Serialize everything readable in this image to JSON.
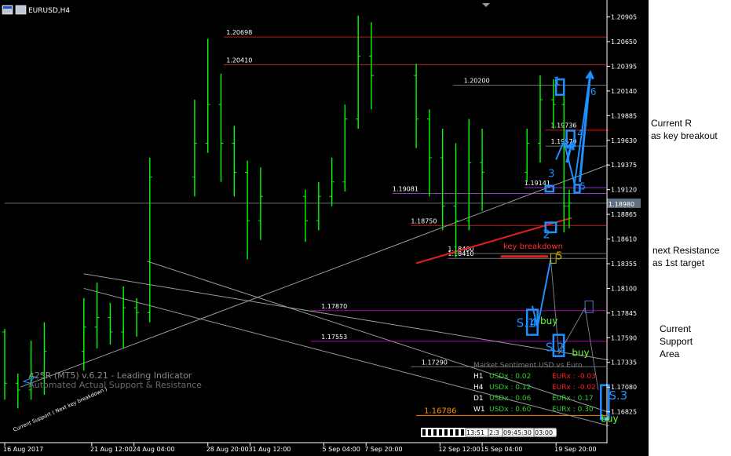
{
  "window": {
    "title": "EURUSD,H4"
  },
  "price_axis": {
    "ticks": [
      "1.20905",
      "1.20650",
      "1.20395",
      "1.20140",
      "1.19885",
      "1.19630",
      "1.19375",
      "1.19120",
      "1.18865",
      "1.18610",
      "1.18355",
      "1.18100",
      "1.17845",
      "1.17590",
      "1.17335",
      "1.17080",
      "1.16825"
    ],
    "current_price": "1.18980"
  },
  "time_axis": {
    "labels": [
      "16 Aug 2017",
      "21 Aug 12:00",
      "24 Aug 04:00",
      "28 Aug 20:00",
      "31 Aug 12:00",
      "5 Sep 04:00",
      "7 Sep 20:00",
      "12 Sep 12:00",
      "15 Sep 04:00",
      "19 Sep 20:00"
    ]
  },
  "levels": [
    {
      "label": "1.20698",
      "value": 1.20698,
      "color": "#b22222",
      "x_start": "29 Aug 20:00",
      "label_at": "30 Aug 00:00"
    },
    {
      "label": "1.20410",
      "value": 1.2041,
      "color": "#b22222",
      "x_start": "29 Aug 20:00",
      "label_at": "30 Aug 00:00"
    },
    {
      "label": "1.20200",
      "value": 1.202,
      "color": "#707070",
      "x_start": "13 Sep 08:00",
      "label_at": "14 Sep 00:00"
    },
    {
      "label": "1.19736",
      "value": 1.19736,
      "color": "#b22222",
      "x_start": "19 Sep 04:00",
      "label_at": "19 Sep 12:00"
    },
    {
      "label": "1.19570",
      "value": 1.1957,
      "color": "#707070",
      "x_start": "19 Sep 04:00",
      "label_at": "19 Sep 12:00"
    },
    {
      "label": "1.19081",
      "value": 1.19081,
      "color": "#9932cc",
      "x_start": "9 Sep 12:00",
      "label_at": "9 Sep 12:00"
    },
    {
      "label": "1.19141",
      "value": 1.19141,
      "color": "#9932cc",
      "x_start": "17 Sep 20:00",
      "label_at": "17 Sep 20:00"
    },
    {
      "label": "1.18750",
      "value": 1.1875,
      "color": "#b22222",
      "x_start": "10 Sep 16:00",
      "label_at": "10 Sep 16:00"
    },
    {
      "label": "1.18460",
      "value": 1.1846,
      "color": "#707070",
      "x_start": "13 Sep 00:00",
      "label_at": "13 Sep 00:00"
    },
    {
      "label": "1.18410",
      "value": 1.1841,
      "color": "#707070",
      "x_start": "13 Sep 00:00",
      "label_at": "13 Sep 00:00"
    },
    {
      "label": "1.17870",
      "value": 1.1787,
      "color": "#b000b0",
      "x_start": "4 Sep 08:00",
      "label_at": "5 Sep 00:00"
    },
    {
      "label": "1.17553",
      "value": 1.17553,
      "color": "#b000b0",
      "x_start": "4 Sep 08:00",
      "label_at": "5 Sep 00:00"
    },
    {
      "label": "1.17290",
      "value": 1.1729,
      "color": "#707070",
      "x_start": "10 Sep 16:00",
      "label_at": "11 Sep 08:00"
    },
    {
      "label": "1.16786",
      "value": 1.16786,
      "color": "#ff8c00",
      "x_start": "11 Sep 00:00",
      "label_at": "11 Sep 12:00"
    }
  ],
  "chart_data": {
    "type": "candlestick",
    "title": "EURUSD,H4",
    "x_range": [
      "16 Aug 2017 00:00",
      "23 Sep 2017 04:00"
    ],
    "ylim": [
      1.1653,
      1.2108
    ],
    "current_price": 1.1898,
    "series": [
      {
        "name": "EURUSD,H4",
        "values": [
          [
            "16 Aug 00:00",
            1.1765,
            1.1768,
            1.1695,
            1.1712
          ],
          [
            "16 Aug 20:00",
            1.1712,
            1.1722,
            1.1686,
            1.1705
          ],
          [
            "17 Aug 16:00",
            1.1705,
            1.1756,
            1.1695,
            1.1722
          ],
          [
            "18 Aug 12:00",
            1.1722,
            1.1775,
            1.17,
            1.1745
          ],
          [
            "21 Aug 00:00",
            1.1745,
            1.18,
            1.1725,
            1.177
          ],
          [
            "21 Aug 20:00",
            1.177,
            1.1816,
            1.1748,
            1.178
          ],
          [
            "22 Aug 16:00",
            1.178,
            1.1795,
            1.1752,
            1.1765
          ],
          [
            "23 Aug 12:00",
            1.1765,
            1.1812,
            1.1748,
            1.179
          ],
          [
            "24 Aug 08:00",
            1.179,
            1.18,
            1.176,
            1.1785
          ],
          [
            "25 Aug 04:00",
            1.1785,
            1.1945,
            1.1775,
            1.1925
          ],
          [
            "28 Aug 00:00",
            1.1925,
            1.2005,
            1.1905,
            1.196
          ],
          [
            "28 Aug 20:00",
            1.196,
            1.2068,
            1.195,
            1.2
          ],
          [
            "29 Aug 16:00",
            1.2,
            1.2032,
            1.192,
            1.196
          ],
          [
            "30 Aug 12:00",
            1.196,
            1.1978,
            1.1905,
            1.193
          ],
          [
            "31 Aug 08:00",
            1.193,
            1.1942,
            1.184,
            1.188
          ],
          [
            "1 Sep 04:00",
            1.188,
            1.1935,
            1.186,
            1.1905
          ],
          [
            "4 Sep 00:00",
            1.1905,
            1.1912,
            1.1858,
            1.188
          ],
          [
            "4 Sep 20:00",
            1.188,
            1.192,
            1.187,
            1.1905
          ],
          [
            "5 Sep 16:00",
            1.1905,
            1.1945,
            1.1895,
            1.192
          ],
          [
            "6 Sep 12:00",
            1.192,
            1.2,
            1.191,
            1.1985
          ],
          [
            "7 Sep 08:00",
            1.1985,
            1.2092,
            1.1975,
            1.205
          ],
          [
            "8 Sep 04:00",
            1.205,
            1.2085,
            1.1995,
            1.203
          ],
          [
            "11 Sep 00:00",
            1.203,
            1.2042,
            1.1955,
            1.1985
          ],
          [
            "11 Sep 20:00",
            1.1985,
            1.1995,
            1.1905,
            1.1945
          ],
          [
            "12 Sep 16:00",
            1.1945,
            1.1975,
            1.187,
            1.1895
          ],
          [
            "13 Sep 12:00",
            1.1895,
            1.196,
            1.1842,
            1.188
          ],
          [
            "14 Sep 08:00",
            1.188,
            1.1985,
            1.187,
            1.194
          ],
          [
            "15 Sep 04:00",
            1.194,
            1.1975,
            1.189,
            1.193
          ],
          [
            "18 Sep 00:00",
            1.193,
            1.1975,
            1.192,
            1.196
          ],
          [
            "18 Sep 20:00",
            1.196,
            1.203,
            1.194,
            1.2005
          ],
          [
            "19 Sep 16:00",
            1.2005,
            1.2026,
            1.1975,
            1.2
          ],
          [
            "20 Sep 08:00",
            1.2,
            1.2015,
            1.1868,
            1.1895
          ],
          [
            "20 Sep 16:00",
            1.1895,
            1.1912,
            1.1872,
            1.1898
          ]
        ]
      }
    ]
  },
  "trendlines": [
    {
      "name": "support-line",
      "from": [
        "17 Aug 00:00",
        1.1708
      ],
      "to": [
        "23 Sep 04:00",
        1.1938
      ],
      "color": "#9a9a9a",
      "width": 1
    },
    {
      "name": "channel-upper",
      "from": [
        "21 Aug 00:00",
        1.1825
      ],
      "to": [
        "23 Sep 04:00",
        1.1736
      ],
      "color": "#9a9a9a",
      "width": 1
    },
    {
      "name": "channel-middle",
      "from": [
        "25 Aug 00:00",
        1.1838
      ],
      "to": [
        "23 Sep 04:00",
        1.1682
      ],
      "color": "#9a9a9a",
      "width": 1
    },
    {
      "name": "channel-lower",
      "from": [
        "21 Aug 00:00",
        1.181
      ],
      "to": [
        "23 Sep 04:00",
        1.1668
      ],
      "color": "#9a9a9a",
      "width": 1
    },
    {
      "name": "current-price-line",
      "from": [
        "16 Aug 00:00",
        1.1898
      ],
      "to": [
        "23 Sep 04:00",
        1.1898
      ],
      "color": "#607080",
      "width": 1
    },
    {
      "name": "key-breakdown-trendline",
      "from": [
        "11 Sep 00:00",
        1.1836
      ],
      "to": [
        "20 Sep 20:00",
        1.1883
      ],
      "color": "#e02020",
      "width": 2
    },
    {
      "name": "key-breakdown-segment",
      "from": [
        "16 Sep 08:00",
        1.1843
      ],
      "to": [
        "19 Sep 08:00",
        1.1843
      ],
      "color": "#e02020",
      "width": 3
    },
    {
      "name": "current-r-line",
      "from": [
        "20 Sep 00:00",
        1.19736
      ],
      "to": [
        "23 Sep 04:00",
        1.19736
      ],
      "color": "#8b0000",
      "width": 2
    }
  ],
  "wave_paths": [
    {
      "name": "projection-path-1",
      "points": [
        [
          "19 Sep 20:00",
          1.1943
        ],
        [
          "20 Sep 08:00",
          1.1962
        ],
        [
          "21 Sep 00:00",
          1.1918
        ],
        [
          "22 Sep 00:00",
          1.2033
        ]
      ],
      "color": "#1e90ff",
      "width": 2
    },
    {
      "name": "projection-path-2",
      "points": [
        [
          "18 Sep 08:00",
          1.1792
        ],
        [
          "18 Sep 16:00",
          1.177
        ],
        [
          "19 Sep 12:00",
          1.184
        ]
      ],
      "color": "#1e90ff",
      "width": 2
    },
    {
      "name": "projection-path-3",
      "points": [
        [
          "19 Sep 12:00",
          1.184
        ],
        [
          "20 Sep 00:00",
          1.1745
        ]
      ],
      "color": "#708090",
      "width": 1
    },
    {
      "name": "projection-path-4",
      "points": [
        [
          "20 Sep 00:00",
          1.1742
        ],
        [
          "21 Sep 16:00",
          1.179
        ],
        [
          "22 Sep 12:00",
          1.1705
        ]
      ],
      "color": "#708090",
      "width": 1
    }
  ],
  "boxes": [
    {
      "name": "wave-box-1",
      "x1": "19 Sep 20:00",
      "x2": "20 Sep 08:00",
      "y1": 1.2026,
      "y2": 1.201,
      "color": "#1e90ff"
    },
    {
      "name": "wave-box-2",
      "x1": "19 Sep 04:00",
      "x2": "19 Sep 20:00",
      "y1": 1.1878,
      "y2": 1.1868,
      "color": "#1e90ff"
    },
    {
      "name": "wave-box-3",
      "x1": "19 Sep 04:00",
      "x2": "19 Sep 16:00",
      "y1": 1.1916,
      "y2": 1.191,
      "color": "#1e90ff"
    },
    {
      "name": "wave-box-a",
      "x1": "20 Sep 12:00",
      "x2": "21 Sep 00:00",
      "y1": 1.1973,
      "y2": 1.1957,
      "color": "#1e90ff"
    },
    {
      "name": "wave-box-5",
      "x1": "21 Sep 00:00",
      "x2": "21 Sep 08:00",
      "y1": 1.1917,
      "y2": 1.1909,
      "color": "#1e90ff"
    },
    {
      "name": "target-box-5",
      "x1": "19 Sep 12:00",
      "x2": "19 Sep 20:00",
      "y1": 1.1846,
      "y2": 1.1836,
      "color": "#d4b400"
    },
    {
      "name": "support-box-4",
      "x1": "18 Sep 00:00",
      "x2": "18 Sep 16:00",
      "y1": 1.1788,
      "y2": 1.1762,
      "color": "#1e90ff"
    },
    {
      "name": "support-box-s2",
      "x1": "19 Sep 16:00",
      "x2": "20 Sep 08:00",
      "y1": 1.1762,
      "y2": 1.174,
      "color": "#1e90ff"
    },
    {
      "name": "support-box-small",
      "x1": "21 Sep 16:00",
      "x2": "22 Sep 04:00",
      "y1": 1.1797,
      "y2": 1.1785,
      "color": "#4a78c8"
    },
    {
      "name": "support-box-s3",
      "x1": "22 Sep 16:00",
      "x2": "23 Sep 04:00",
      "y1": 1.171,
      "y2": 1.1675,
      "color": "#1e90ff"
    }
  ],
  "arrows": [
    {
      "name": "arrow-up-6",
      "from": [
        "21 Sep 08:00",
        1.192
      ],
      "to": [
        "22 Sep 00:00",
        1.2033
      ],
      "color": "#1e90ff"
    },
    {
      "name": "arrow-up-a",
      "from": [
        "20 Sep 12:00",
        1.194
      ],
      "to": [
        "20 Sep 20:00",
        1.196
      ],
      "color": "#1e90ff"
    }
  ],
  "wave_labels": [
    {
      "name": "wave-label-1",
      "text": "1",
      "at": [
        "19 Sep 16:00",
        1.202
      ],
      "color": "#1e90ff",
      "size": 15
    },
    {
      "name": "wave-label-2",
      "text": "2",
      "at": [
        "19 Sep 00:00",
        1.1862
      ],
      "color": "#1e90ff",
      "size": 15
    },
    {
      "name": "wave-label-3",
      "text": "3",
      "at": [
        "19 Sep 08:00",
        1.1925
      ],
      "color": "#1e90ff",
      "size": 13
    },
    {
      "name": "wave-label-4-top",
      "text": "4",
      "at": [
        "21 Sep 04:00",
        1.1967
      ],
      "color": "#1e90ff",
      "size": 12
    },
    {
      "name": "wave-label-5-top",
      "text": "5",
      "at": [
        "21 Sep 08:00",
        1.1912
      ],
      "color": "#1e90ff",
      "size": 12
    },
    {
      "name": "wave-label-6",
      "text": "6",
      "at": [
        "22 Sep 00:00",
        1.201
      ],
      "color": "#1e90ff",
      "size": 12
    },
    {
      "name": "wave-label-5-target",
      "text": "5",
      "at": [
        "19 Sep 20:00",
        1.184
      ],
      "color": "#d4b400",
      "size": 13
    },
    {
      "name": "wave-label-s1",
      "text": "S.1",
      "at": [
        "17 Sep 08:00",
        1.177
      ],
      "color": "#1e90ff",
      "size": 15
    },
    {
      "name": "wave-label-4-low",
      "text": "4",
      "at": [
        "18 Sep 04:00",
        1.177
      ],
      "color": "#1e90ff",
      "size": 15
    },
    {
      "name": "wave-label-s2",
      "text": "S.2",
      "at": [
        "19 Sep 04:00",
        1.1745
      ],
      "color": "#1e90ff",
      "size": 15
    },
    {
      "name": "wave-label-s3",
      "text": "S.3",
      "at": [
        "23 Sep 04:00",
        1.1695
      ],
      "color": "#1e90ff",
      "size": 15
    },
    {
      "name": "buy-label-1",
      "text": "buy",
      "at": [
        "18 Sep 20:00",
        1.1773
      ],
      "color": "#66ff33",
      "size": 12
    },
    {
      "name": "buy-label-2",
      "text": "buy",
      "at": [
        "20 Sep 20:00",
        1.174
      ],
      "color": "#66ff33",
      "size": 12
    },
    {
      "name": "buy-label-3",
      "text": "buy",
      "at": [
        "22 Sep 16:00",
        1.1672
      ],
      "color": "#66ff33",
      "size": 12
    }
  ],
  "key_breakdown": {
    "text": "key breakdown",
    "color": "#ff3030"
  },
  "indicator": {
    "name": "A2SR (MT5) v.6.21 - Leading Indicator",
    "subtitle": "Automated Actual Support & Resistance",
    "support_tag": "Current Support ( Next key breakdown )"
  },
  "market_sentiment": {
    "title": "Market Sentiment USD vs Euro",
    "rows": [
      {
        "tf": "H1",
        "usd": "USDx : 0.02",
        "eur": "EURx : -0.03",
        "usd_color": "#33cc33",
        "eur_color": "#ff2020"
      },
      {
        "tf": "H4",
        "usd": "USDx : 0.12",
        "eur": "EURx : -0.02",
        "usd_color": "#33cc33",
        "eur_color": "#ff2020"
      },
      {
        "tf": "D1",
        "usd": "USDx : 0.06",
        "eur": "EURx : 0.17",
        "usd_color": "#33cc33",
        "eur_color": "#33cc33"
      },
      {
        "tf": "W1",
        "usd": "USDx : 0.60",
        "eur": "EURx : 0.30",
        "usd_color": "#33cc33",
        "eur_color": "#33cc33"
      }
    ]
  },
  "timer": {
    "labels": [
      "13:51",
      "2:3",
      "09:45:30",
      "03:00"
    ]
  },
  "annotations": {
    "current_r_line1": "Current R",
    "current_r_line2": "as key breakout",
    "next_res_line1": "next Resistance",
    "next_res_line2": "as 1st target",
    "support_line1": "Current",
    "support_line2": "Support",
    "support_line3": "Area"
  },
  "colors": {
    "background": "#000000",
    "candle": "#00ff00",
    "axis_text": "#ffffff",
    "grid": "#606060"
  }
}
